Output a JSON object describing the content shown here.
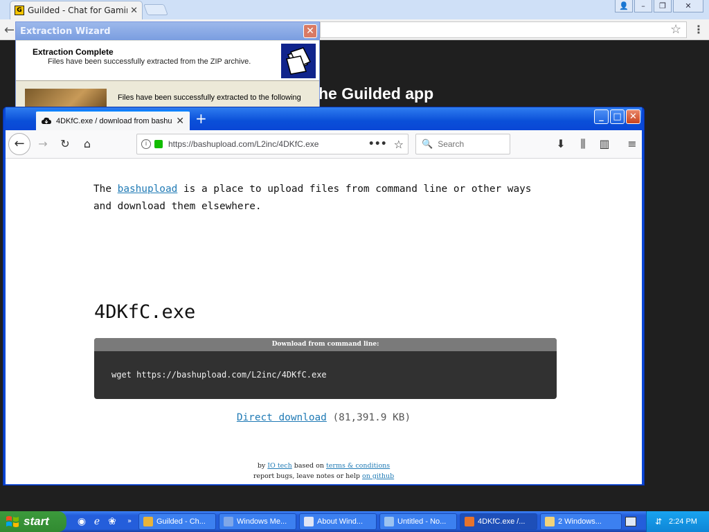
{
  "chrome": {
    "tab_title": "Guilded - Chat for Gaming Co",
    "page_heading": "he Guilded app"
  },
  "wizard": {
    "title": "Extraction Wizard",
    "header_title": "Extraction Complete",
    "header_subtitle": "Files have been successfully extracted from the ZIP archive.",
    "body_text": "Files have been successfully extracted to the following"
  },
  "firefox": {
    "tab_title": "4DKfC.exe / download from bashu",
    "url": "https://bashupload.com/L2inc/4DKfC.exe",
    "search_placeholder": "Search"
  },
  "page": {
    "intro_before": "The ",
    "intro_link": "bashupload",
    "intro_after": " is a place to upload files from command line or other ways and download them elsewhere.",
    "file_name": "4DKfC.exe",
    "cmd_header": "Download from command line:",
    "cmd": "wget https://bashupload.com/L2inc/4DKfC.exe",
    "direct_link": "Direct download",
    "direct_size": " (81,391.9 KB)",
    "footer_by": "by ",
    "footer_io": "IO tech",
    "footer_based": " based on ",
    "footer_terms": "terms & conditions",
    "footer_report": "report bugs, leave notes or help ",
    "footer_github": "on github"
  },
  "taskbar": {
    "start_label": "start",
    "tasks": [
      {
        "label": "Guilded - Ch...",
        "icon_color": "#e8b33a"
      },
      {
        "label": "Windows Me...",
        "icon_color": "#7fa7e8"
      },
      {
        "label": "About Wind...",
        "icon_color": "#e0e6f5"
      },
      {
        "label": "Untitled - No...",
        "icon_color": "#9cc3f0"
      },
      {
        "label": "4DKfC.exe /...",
        "icon_color": "#e7732c"
      },
      {
        "label": "2 Windows...",
        "icon_color": "#f1d37a"
      }
    ],
    "clock": "2:24 PM"
  },
  "colors": {
    "link": "#1f7ab5",
    "xp_blue": "#245edb",
    "start_green": "#318a31"
  }
}
